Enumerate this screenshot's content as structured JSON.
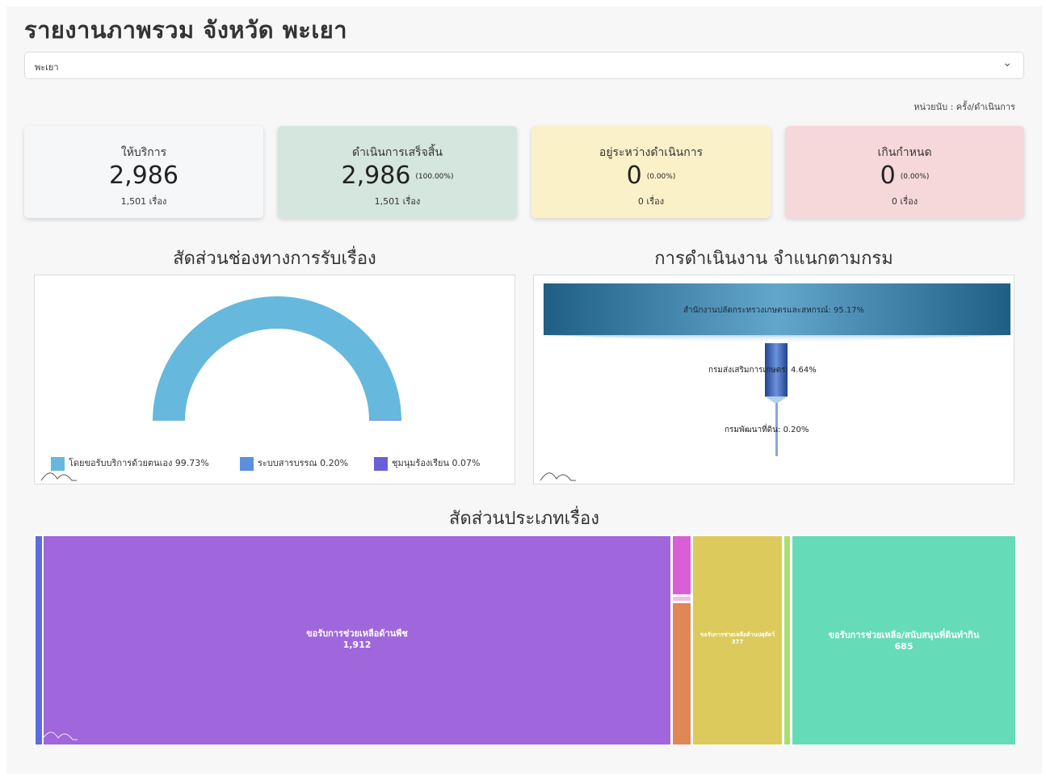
{
  "page": {
    "title": "รายงานภาพรวม จังหวัด พะเยา"
  },
  "province_select": {
    "value": "พะเยา"
  },
  "unit_text": "หน่วยนับ : ครั้ง/ดำเนินการ",
  "cards": [
    {
      "label": "ให้บริการ",
      "value": "2,986",
      "percent": "",
      "sub": "1,501 เรื่อง",
      "bg": "#f6f7f8"
    },
    {
      "label": "ดำเนินการเสร็จสิ้น",
      "value": "2,986",
      "percent": "(100.00%)",
      "sub": "1,501 เรื่อง",
      "bg": "#d4e6dd"
    },
    {
      "label": "อยู่ระหว่างดำเนินการ",
      "value": "0",
      "percent": "(0.00%)",
      "sub": "0 เรื่อง",
      "bg": "#fbf1c9"
    },
    {
      "label": "เกินกำหนด",
      "value": "0",
      "percent": "(0.00%)",
      "sub": "0 เรื่อง",
      "bg": "#f6d8db"
    }
  ],
  "channel_chart": {
    "title": "สัดส่วนช่องทางการรับเรื่อง",
    "legend": [
      {
        "label": "โดยขอรับบริการด้วยตนเอง 99.73%",
        "color": "#66b8dd"
      },
      {
        "label": "ระบบสารบรรณ 0.20%",
        "color": "#5b8fe0"
      },
      {
        "label": "ชุมนุมร้องเรียน 0.07%",
        "color": "#6a5fd9"
      }
    ]
  },
  "department_chart": {
    "title": "การดำเนินงาน จำแนกตามกรม",
    "stages": [
      {
        "label": "สำนักงานปลัดกระทรวงเกษตรและสหกรณ์: 95.17%"
      },
      {
        "label": "กรมส่งเสริมการเกษตร: 4.64%"
      },
      {
        "label": "กรมพัฒนาที่ดิน: 0.20%"
      }
    ]
  },
  "type_chart": {
    "title": "สัดส่วนประเภทเรื่อง",
    "tiles": [
      {
        "label": "ขอรับการช่วยเหลือด้านพืช",
        "value": "1,912",
        "color": "#a066dc"
      },
      {
        "label": "ขอรับการช่วยเหลือด้านปศุสัตว์",
        "value": "377",
        "color": "#dccb5c"
      },
      {
        "label": "ขอรับการช่วยเหลือ/สนับสนุนที่ดินทำกิน",
        "value": "685",
        "color": "#66dbb8"
      }
    ]
  },
  "chart_data": [
    {
      "type": "pie",
      "title": "สัดส่วนช่องทางการรับเรื่อง",
      "categories": [
        "โดยขอรับบริการด้วยตนเอง",
        "ระบบสารบรรณ",
        "ชุมนุมร้องเรียน"
      ],
      "values": [
        99.73,
        0.2,
        0.07
      ],
      "colors": [
        "#66b8dd",
        "#5b8fe0",
        "#6a5fd9"
      ],
      "style": "semi-donut",
      "legend": "bottom"
    },
    {
      "type": "bar",
      "style": "funnel",
      "title": "การดำเนินงาน จำแนกตามกรม",
      "categories": [
        "สำนักงานปลัดกระทรวงเกษตรและสหกรณ์",
        "กรมส่งเสริมการเกษตร",
        "กรมพัฒนาที่ดิน"
      ],
      "values": [
        95.17,
        4.64,
        0.2
      ]
    },
    {
      "type": "treemap",
      "title": "สัดส่วนประเภทเรื่อง",
      "categories": [
        "ขอรับการช่วยเหลือด้านพืช",
        "ขอรับการช่วยเหลือด้านปศุสัตว์",
        "ขอรับการช่วยเหลือ/สนับสนุนที่ดินทำกิน"
      ],
      "values": [
        1912,
        377,
        685
      ]
    }
  ]
}
